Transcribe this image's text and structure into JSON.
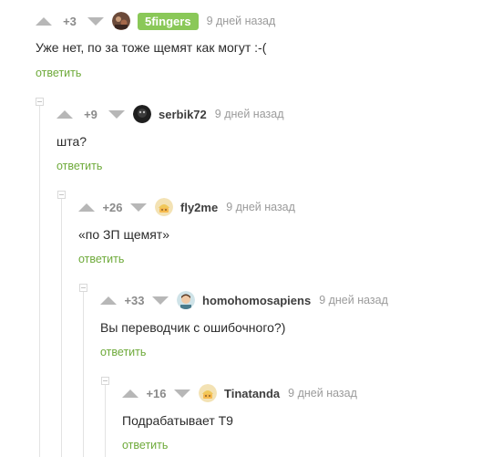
{
  "comments": [
    {
      "rating": "+3",
      "nick": "5fingers",
      "time": "9 дней назад",
      "text": "Уже нет, по за тоже щемят как могут :-(",
      "reply": "ответить"
    },
    {
      "rating": "+9",
      "nick": "serbik72",
      "time": "9 дней назад",
      "text": "шта?",
      "reply": "ответить"
    },
    {
      "rating": "+26",
      "nick": "fly2me",
      "time": "9 дней назад",
      "text": "«по ЗП щемят»",
      "reply": "ответить"
    },
    {
      "rating": "+33",
      "nick": "homohomosapiens",
      "time": "9 дней назад",
      "text": "Вы переводчик с ошибочного?)",
      "reply": "ответить"
    },
    {
      "rating": "+16",
      "nick": "Tinatanda",
      "time": "9 дней назад",
      "text": "Подрабатывает Т9",
      "reply": "ответить"
    }
  ],
  "colors": {
    "accent": "#6eaa3a",
    "badge": "#8ac858",
    "vote_arrow": "#b7b7b7",
    "thread_line": "#e3e3e3"
  },
  "icons": {
    "vote_up": "triangle-up-icon",
    "vote_down": "triangle-down-icon",
    "collapse": "minus-square-icon"
  }
}
